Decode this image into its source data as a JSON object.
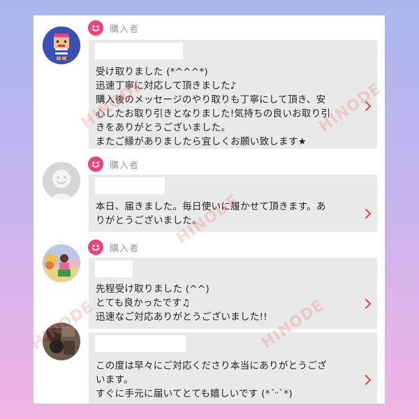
{
  "reviews": [
    {
      "role_label": "購入者",
      "avatar_icon": "cartoon-character-avatar-icon",
      "lines": [
        "受け取りました (*^^^*)",
        "迅速丁寧に対応して頂きました♪",
        "購入後のメッセージのやり取りも丁寧にして頂き、安",
        "心したお取り引きとなりました!気持ちの良いお取り引",
        "きをありがとうございました。",
        "またご縁がありましたら宜しくお願い致します★"
      ]
    },
    {
      "role_label": "購入者",
      "avatar_icon": "default-user-avatar-icon",
      "lines": [
        "本日、届きました。毎日使いに履かせて頂きます。あ",
        "りがとうございました。"
      ]
    },
    {
      "role_label": "購入者",
      "avatar_icon": "figurine-photo-avatar-icon",
      "lines": [
        "先程受け取りました (^^)",
        "とても良かったです♫",
        "迅速なご対応ありがとうございました!!"
      ]
    },
    {
      "role_label": "",
      "avatar_icon": "dark-photo-avatar-icon",
      "lines": [
        "この度は早々にご対応くださり本当にありがとうござ",
        "います。",
        "すぐに手元に届いてとても嬉しいです (*´ᵕ`*)"
      ]
    }
  ],
  "watermark": "HINODE",
  "colors": {
    "accent_pink": "#e8437a",
    "chevron_red": "#e04b4b",
    "bubble_gray": "#e9e9e9",
    "watermark": "rgba(235,120,120,0.28)"
  }
}
